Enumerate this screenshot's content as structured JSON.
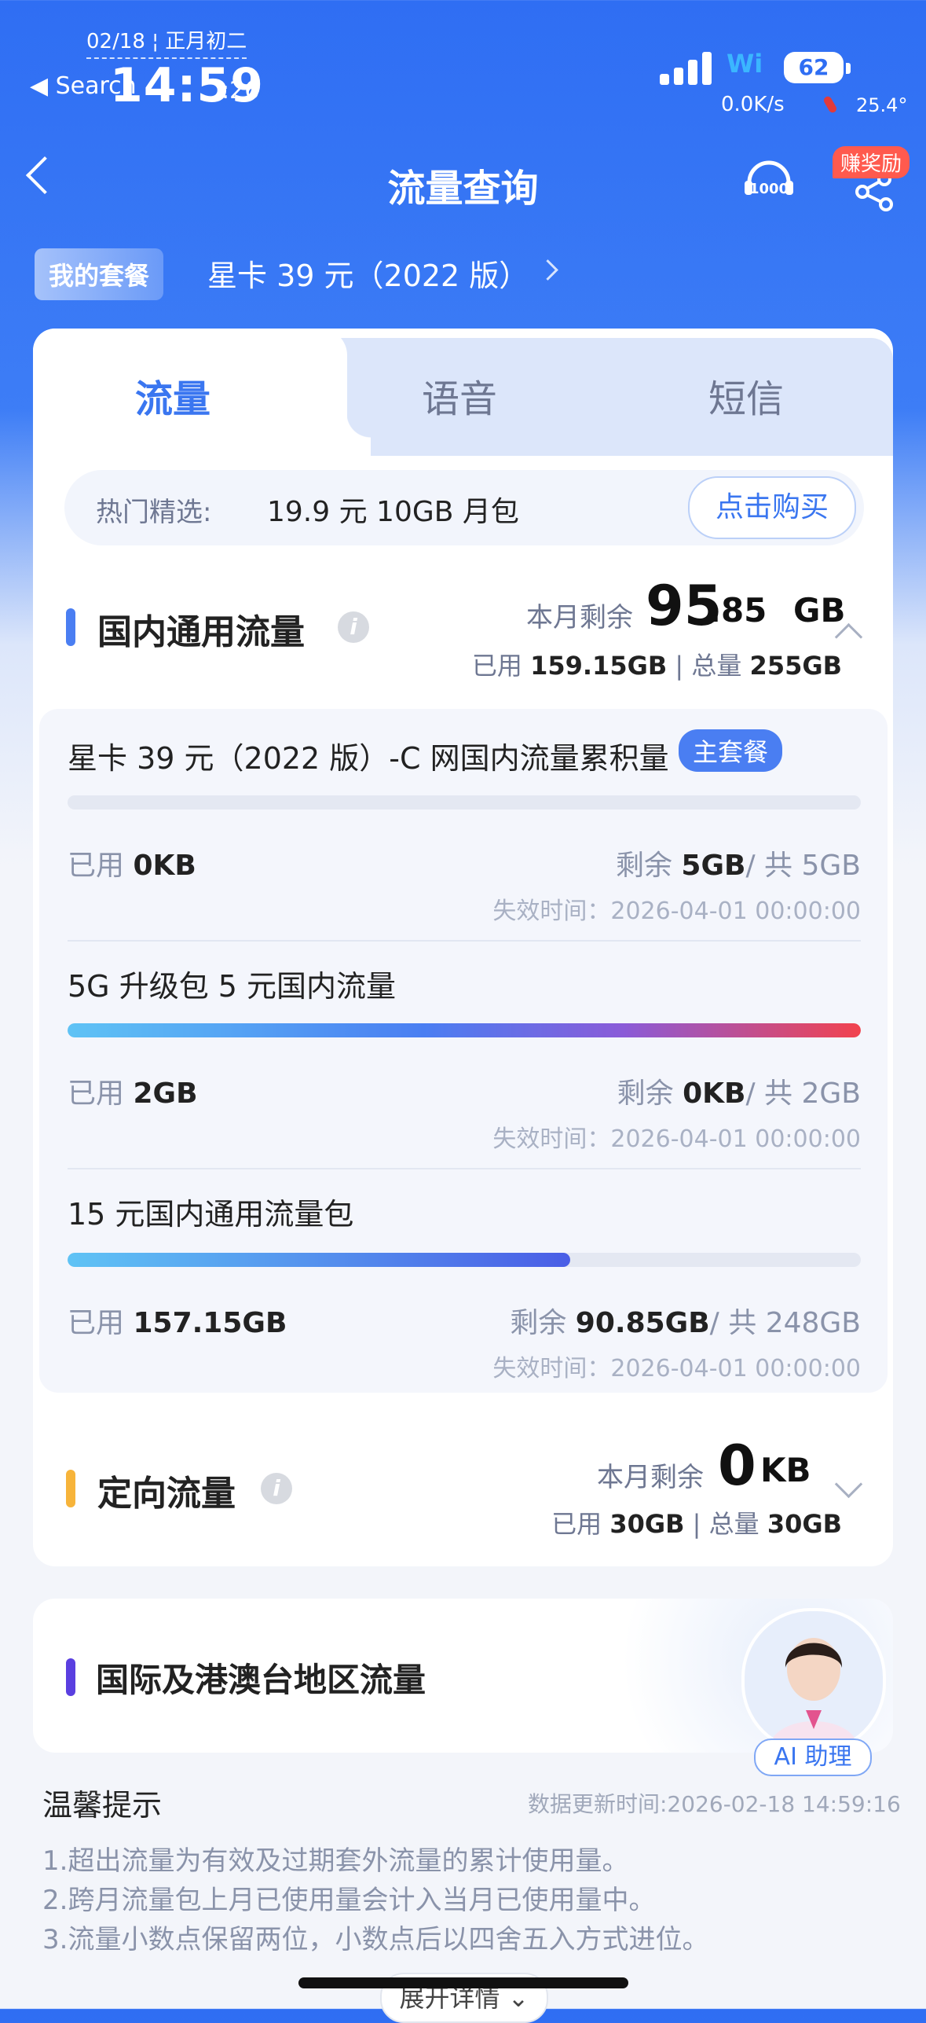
{
  "status_bar": {
    "date": "02/18 ¦ 正月初二",
    "back_app": "◀ Search",
    "time": "14:59",
    "seconds": ":26",
    "wifi_label": "Wi",
    "battery": "62",
    "net_speed": "0.0K/s",
    "temperature": "25.4°"
  },
  "nav": {
    "title": "流量查询",
    "reward_badge": "赚奖励"
  },
  "plan": {
    "badge": "我的套餐",
    "name": "星卡 39 元（2022 版）"
  },
  "tabs": [
    {
      "label": "流量",
      "active": true
    },
    {
      "label": "语音",
      "active": false
    },
    {
      "label": "短信",
      "active": false
    }
  ],
  "promo": {
    "label": "热门精选:",
    "text": "19.9 元 10GB 月包",
    "button": "点击购买"
  },
  "domestic": {
    "title": "国内通用流量",
    "remain_label": "本月剩余",
    "remain_int": "95",
    "remain_frac": ".85",
    "remain_unit": "GB",
    "used_label": "已用",
    "used_value": "159.15GB",
    "total_label": "总量",
    "total_value": "255GB",
    "accent": "#4A7EF2",
    "packages": [
      {
        "name": "星卡 39 元（2022 版）-C 网国内流量累积量",
        "tag": "主套餐",
        "progress": 0,
        "used_label": "已用",
        "used": "0KB",
        "remain_label": "剩余",
        "remain": "5GB",
        "total_label": "/ 共",
        "total": "5GB",
        "expire": "失效时间：2026-04-01 00:00:00"
      },
      {
        "name": "5G 升级包 5 元国内流量",
        "tag": "",
        "progress": 1.0,
        "used_label": "已用",
        "used": "2GB",
        "remain_label": "剩余",
        "remain": "0KB",
        "total_label": "/ 共",
        "total": "2GB",
        "expire": "失效时间：2026-04-01 00:00:00"
      },
      {
        "name": "15 元国内通用流量包",
        "tag": "",
        "progress": 0.634,
        "used_label": "已用",
        "used": "157.15GB",
        "remain_label": "剩余",
        "remain": "90.85GB",
        "total_label": "/ 共",
        "total": "248GB",
        "expire": "失效时间：2026-04-01 00:00:00"
      }
    ]
  },
  "directed": {
    "title": "定向流量",
    "remain_label": "本月剩余",
    "remain_int": "0",
    "remain_unit": "KB",
    "used_label": "已用",
    "used_value": "30GB",
    "total_label": "总量",
    "total_value": "30GB",
    "accent": "#F7B43A"
  },
  "international": {
    "title": "国际及港澳台地区流量",
    "accent": "#5A3FE0",
    "ai_label": "AI 助理"
  },
  "tips": {
    "title": "温馨提示",
    "update_time": "数据更新时间:2026-02-18 14:59:16",
    "items": [
      "1.超出流量为有效及过期套外流量的累计使用量。",
      "2.跨月流量包上月已使用量会计入当月已使用量中。",
      "3.流量小数点保留两位，小数点后以四舍五入方式进位。"
    ],
    "expand": "展开详情 ⌄"
  }
}
